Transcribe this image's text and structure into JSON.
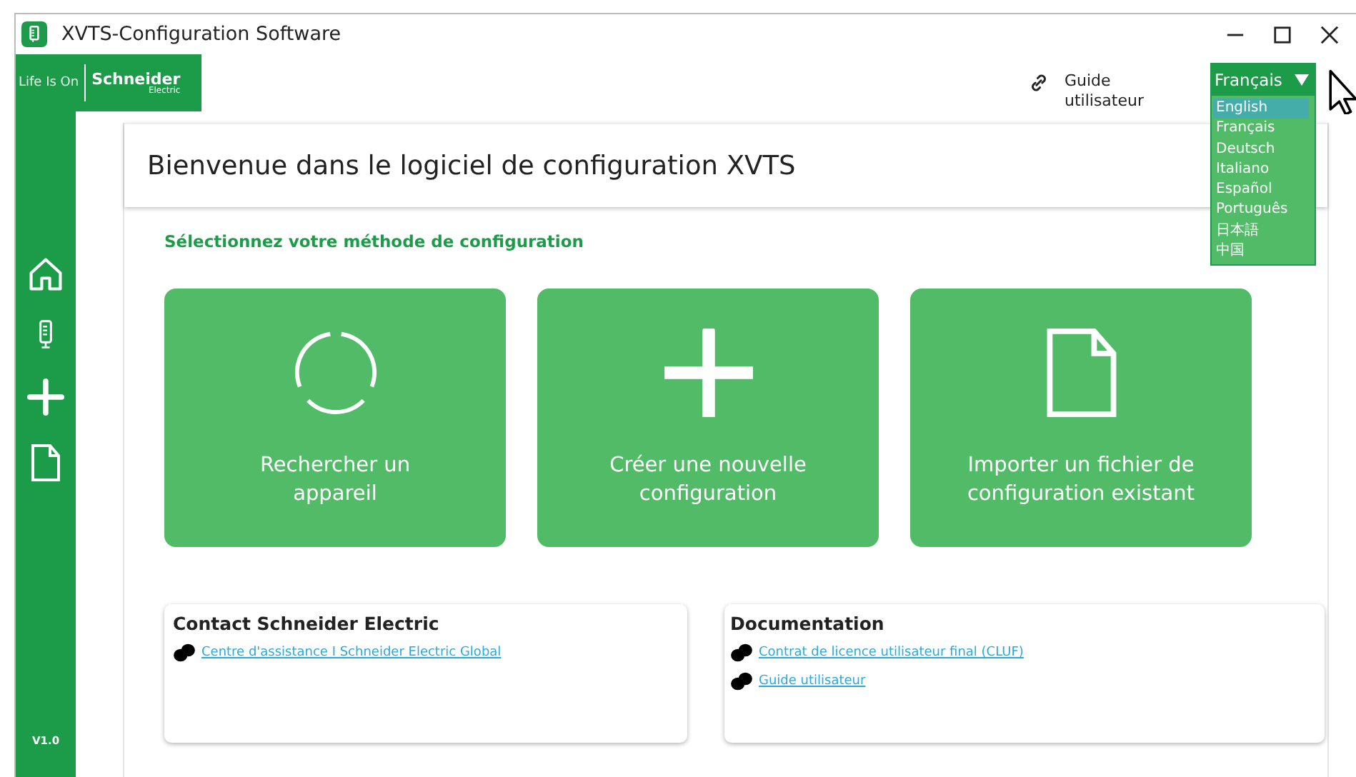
{
  "window": {
    "title": "XVTS-Configuration Software"
  },
  "brand": {
    "tagline": "Life Is On",
    "name": "Schneider",
    "sub": "Electric"
  },
  "sidebar": {
    "items": [
      {
        "kind": "home"
      },
      {
        "kind": "device"
      },
      {
        "kind": "plus"
      },
      {
        "kind": "file"
      }
    ],
    "version": "V1.0"
  },
  "guide_link": "Guide utilisateur",
  "language": {
    "current": "Français",
    "options": [
      {
        "label": "English",
        "highlighted": true
      },
      {
        "label": "Français",
        "highlighted": false
      },
      {
        "label": "Deutsch",
        "highlighted": false
      },
      {
        "label": "Italiano",
        "highlighted": false
      },
      {
        "label": "Español",
        "highlighted": false
      },
      {
        "label": "Português",
        "highlighted": false
      },
      {
        "label": "日本語",
        "highlighted": false
      },
      {
        "label": "中国",
        "highlighted": false
      }
    ]
  },
  "welcome": "Bienvenue dans le logiciel de configuration XVTS",
  "prompt": "Sélectionnez votre méthode de configuration",
  "tiles": [
    {
      "kind": "search",
      "label": "Rechercher un appareil"
    },
    {
      "kind": "plus",
      "label": "Créer une nouvelle configuration"
    },
    {
      "kind": "file",
      "label": "Importer un fichier de configuration existant"
    }
  ],
  "cards": [
    {
      "title": "Contact Schneider Electric",
      "links": [
        "Centre d'assistance I Schneider Electric Global"
      ]
    },
    {
      "title": "Documentation",
      "links": [
        "Contrat de licence utilisateur final (CLUF)",
        "Guide utilisateur"
      ]
    }
  ]
}
